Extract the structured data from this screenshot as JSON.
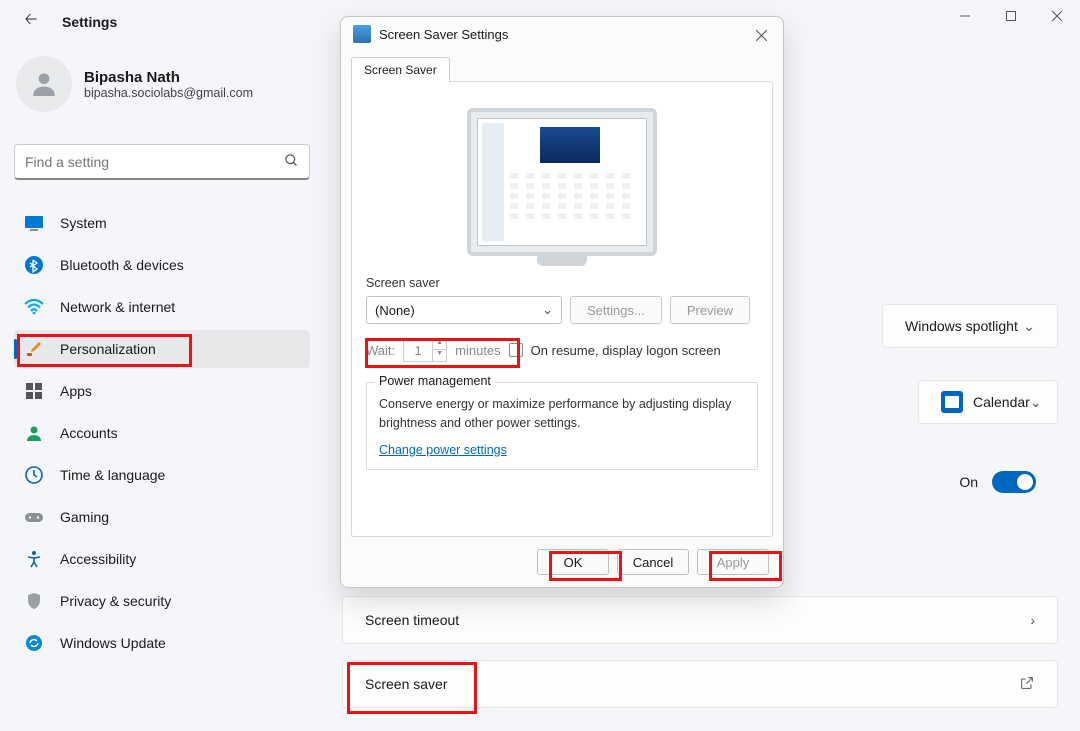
{
  "window": {
    "title": "Settings"
  },
  "account": {
    "name": "Bipasha Nath",
    "email": "bipasha.sociolabs@gmail.com"
  },
  "search": {
    "placeholder": "Find a setting"
  },
  "nav": [
    {
      "label": "System"
    },
    {
      "label": "Bluetooth & devices"
    },
    {
      "label": "Network & internet"
    },
    {
      "label": "Personalization",
      "selected": true,
      "highlighted": true
    },
    {
      "label": "Apps"
    },
    {
      "label": "Accounts"
    },
    {
      "label": "Time & language"
    },
    {
      "label": "Gaming"
    },
    {
      "label": "Accessibility"
    },
    {
      "label": "Privacy & security"
    },
    {
      "label": "Windows Update"
    }
  ],
  "main": {
    "spotlight_label": "Windows spotlight",
    "calendar_label": "Calendar",
    "on_label": "On",
    "timeout_label": "Screen timeout",
    "saver_label": "Screen saver"
  },
  "dialog": {
    "title": "Screen Saver Settings",
    "tab": "Screen Saver",
    "section_label": "Screen saver",
    "select_value": "(None)",
    "settings_btn": "Settings...",
    "preview_btn": "Preview",
    "wait_label": "Wait:",
    "wait_value": "1",
    "wait_unit": "minutes",
    "resume_label": "On resume, display logon screen",
    "power_legend": "Power management",
    "power_body": "Conserve energy or maximize performance by adjusting display brightness and other power settings.",
    "power_link": "Change power settings",
    "ok": "OK",
    "cancel": "Cancel",
    "apply": "Apply"
  }
}
